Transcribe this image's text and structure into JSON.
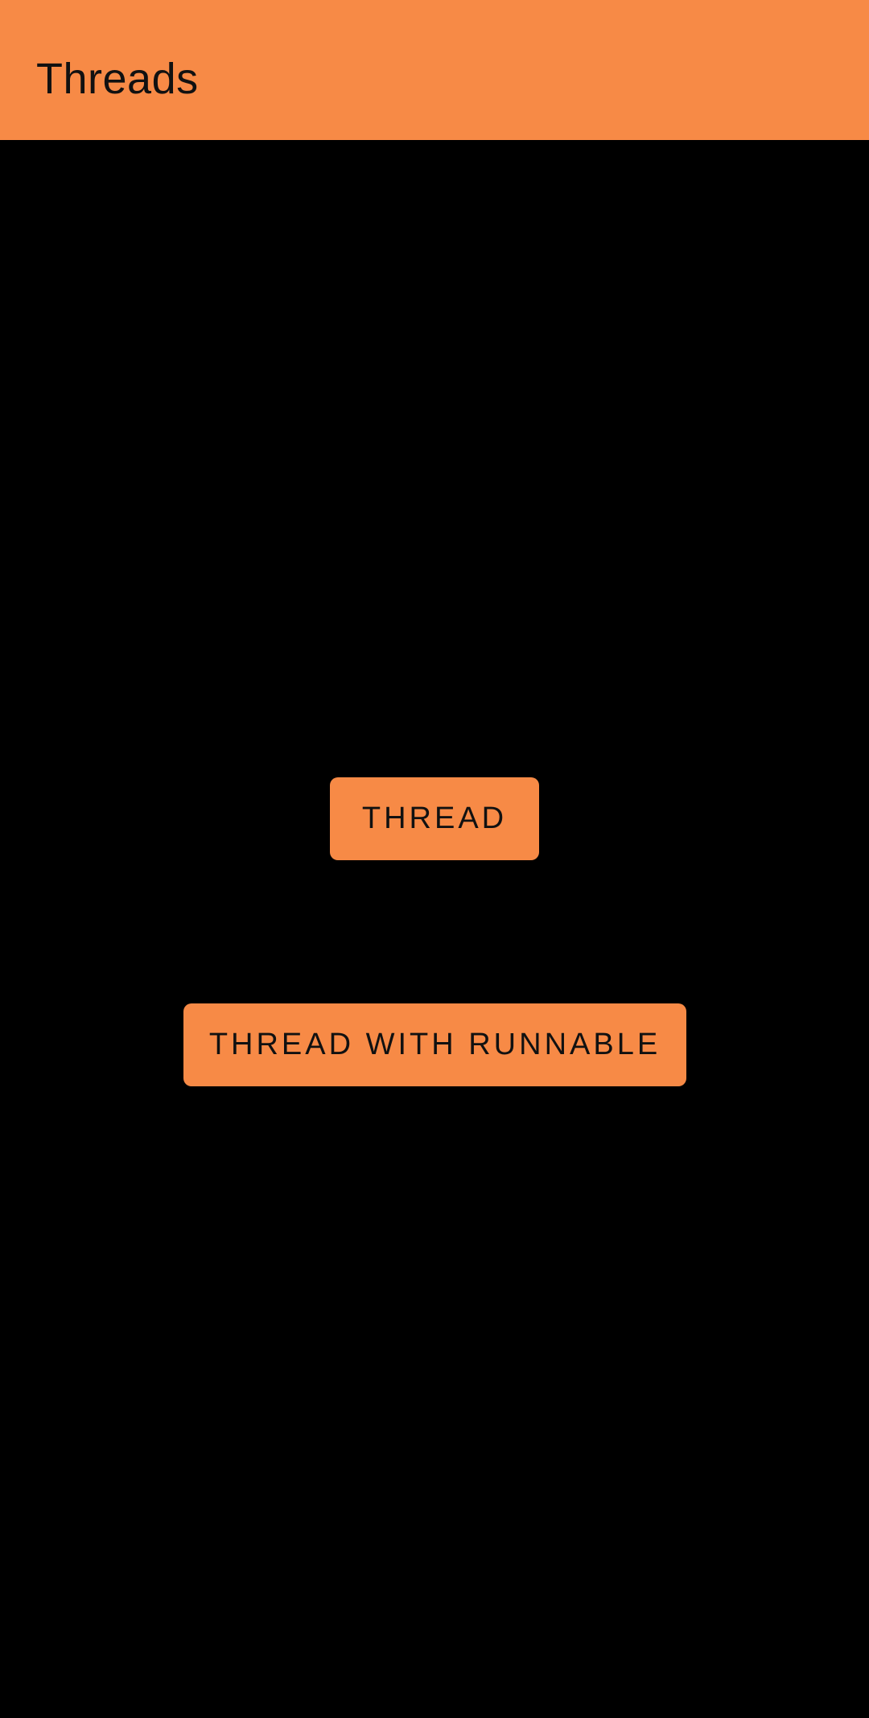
{
  "app_bar": {
    "title": "Threads"
  },
  "buttons": {
    "thread_label": "THREAD",
    "thread_with_runnable_label": "THREAD WITH RUNNABLE"
  },
  "colors": {
    "accent": "#F78A46",
    "background": "#000000",
    "text": "#111111"
  }
}
